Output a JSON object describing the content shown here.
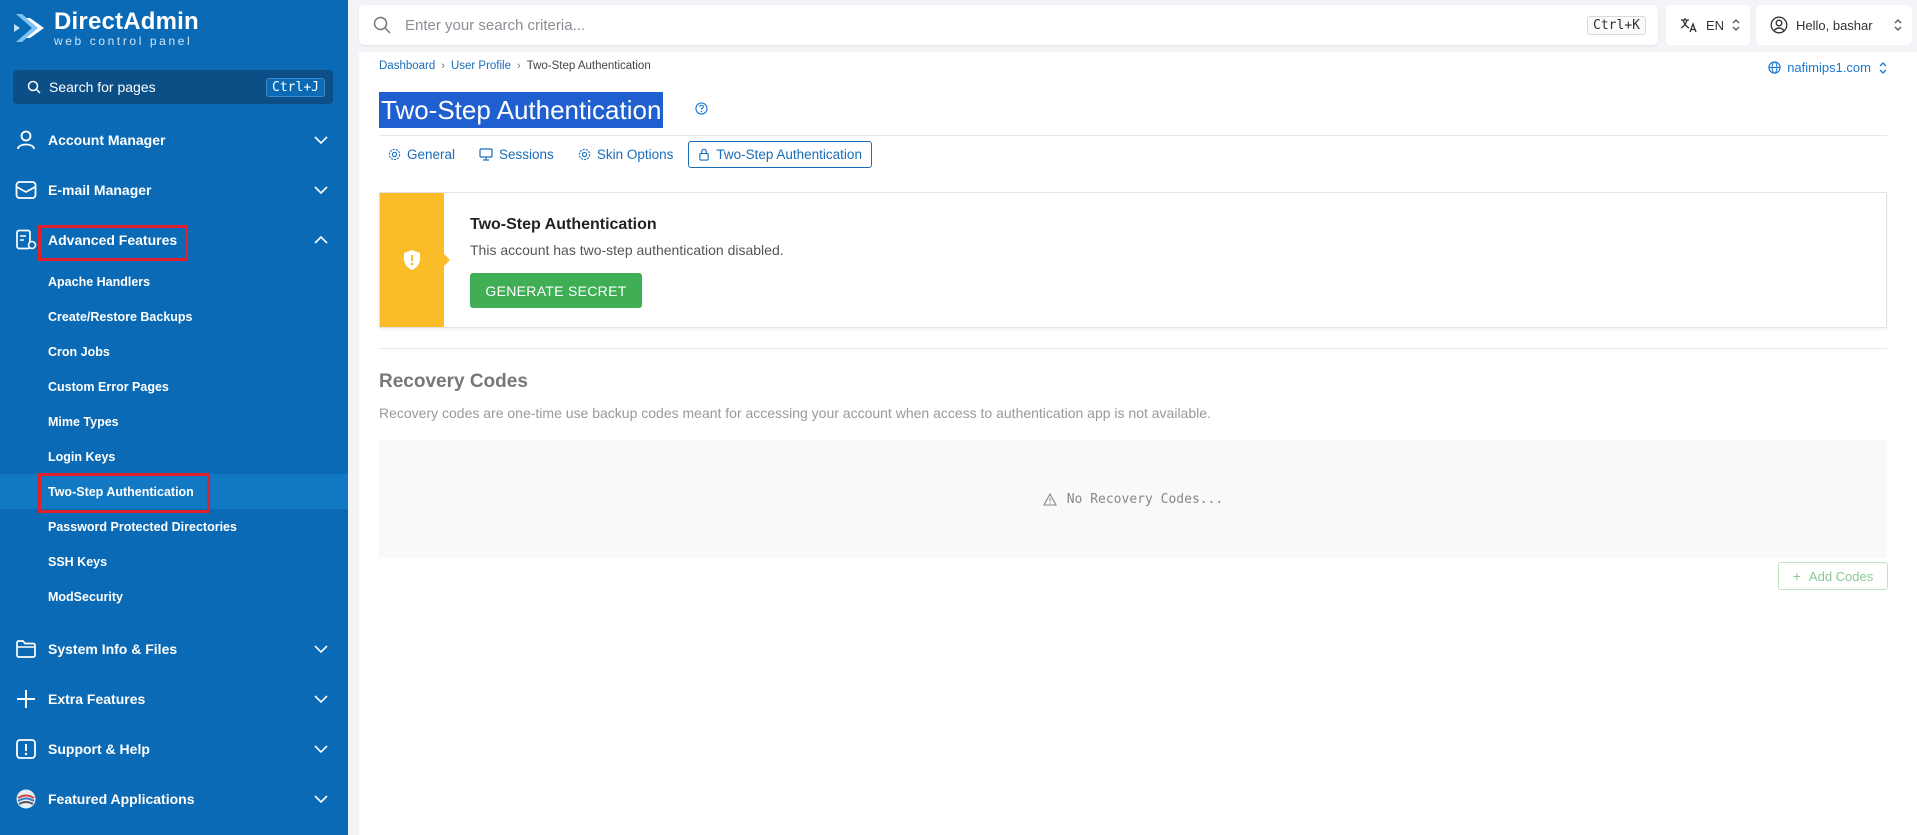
{
  "app": {
    "name": "DirectAdmin",
    "tagline": "web control panel"
  },
  "sidebar": {
    "search_label": "Search for pages",
    "search_shortcut": "Ctrl+J",
    "sections": [
      {
        "label": "Account Manager",
        "icon": "user-icon",
        "expanded": false
      },
      {
        "label": "E-mail Manager",
        "icon": "envelope-icon",
        "expanded": false
      },
      {
        "label": "Advanced Features",
        "icon": "advanced-features-icon",
        "expanded": true
      },
      {
        "label": "System Info & Files",
        "icon": "folder-icon",
        "expanded": false
      },
      {
        "label": "Extra Features",
        "icon": "plus-icon",
        "expanded": false
      },
      {
        "label": "Support & Help",
        "icon": "exclamation-icon",
        "expanded": false
      },
      {
        "label": "Featured Applications",
        "icon": "apps-icon",
        "expanded": false
      }
    ],
    "advanced_items": [
      "Apache Handlers",
      "Create/Restore Backups",
      "Cron Jobs",
      "Custom Error Pages",
      "Mime Types",
      "Login Keys",
      "Two-Step Authentication",
      "Password Protected Directories",
      "SSH Keys",
      "ModSecurity"
    ],
    "active_item": "Two-Step Authentication"
  },
  "topbar": {
    "search_placeholder": "Enter your search criteria...",
    "search_shortcut": "Ctrl+K",
    "language": "EN",
    "greeting": "Hello, bashar"
  },
  "breadcrumb": [
    "Dashboard",
    "User Profile",
    "Two-Step Authentication"
  ],
  "domain": "nafimips1.com",
  "page": {
    "title": "Two-Step Authentication",
    "tabs": [
      {
        "label": "General",
        "icon": "gear-icon",
        "active": false
      },
      {
        "label": "Sessions",
        "icon": "monitor-icon",
        "active": false
      },
      {
        "label": "Skin Options",
        "icon": "gear-icon",
        "active": false
      },
      {
        "label": "Two-Step Authentication",
        "icon": "lock-icon",
        "active": true
      }
    ]
  },
  "status_card": {
    "title": "Two-Step Authentication",
    "description": "This account has two-step authentication disabled.",
    "button": "GENERATE SECRET",
    "accent": "#fbbd27"
  },
  "recovery": {
    "title": "Recovery Codes",
    "description": "Recovery codes are one-time use backup codes meant for accessing your account when access to authentication app is not available.",
    "empty_text": "No Recovery Codes...",
    "add_button": "Add Codes"
  },
  "colors": {
    "sidebar": "#0a6ab5",
    "highlight": "#e0202b",
    "primary_button": "#3fae55"
  }
}
